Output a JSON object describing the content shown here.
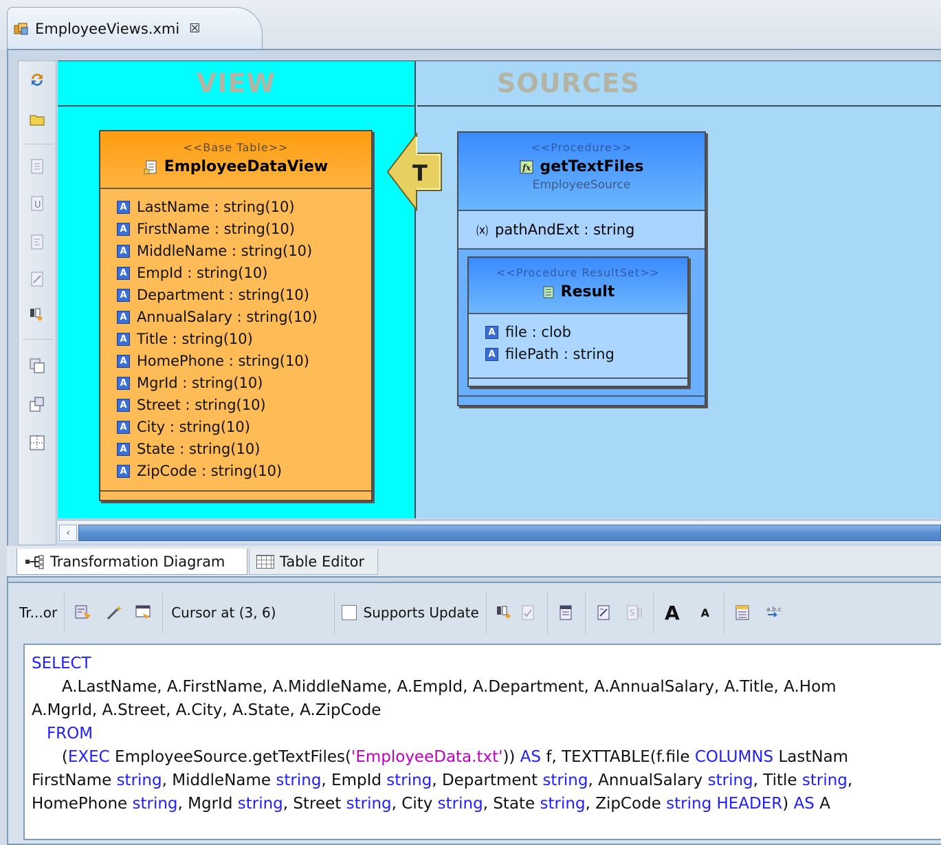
{
  "editor_tab": {
    "title": "EmployeeViews.xmi",
    "close_glyph": "☒"
  },
  "diagram": {
    "view_header": "VIEW",
    "sources_header": "SOURCES",
    "transform_label": "T",
    "view_class": {
      "stereotype": "<<Base Table>>",
      "name": "EmployeeDataView",
      "attributes": [
        "LastName : string(10)",
        "FirstName : string(10)",
        "MiddleName : string(10)",
        "EmpId : string(10)",
        "Department : string(10)",
        "AnnualSalary : string(10)",
        "Title : string(10)",
        "HomePhone : string(10)",
        "MgrId : string(10)",
        "Street : string(10)",
        "City : string(10)",
        "State : string(10)",
        "ZipCode : string(10)"
      ]
    },
    "procedure": {
      "stereotype": "<<Procedure>>",
      "name": "getTextFiles",
      "owner": "EmployeeSource",
      "parameter": "pathAndExt : string",
      "result_set": {
        "stereotype": "<<Procedure ResultSet>>",
        "name": "Result",
        "attributes": [
          "file : clob",
          "filePath : string"
        ]
      }
    },
    "attr_icon_letter": "A"
  },
  "page_tabs": {
    "diagram": "Transformation Diagram",
    "table": "Table Editor"
  },
  "sql_toolbar": {
    "title": "Tr...or",
    "cursor": "Cursor at (3, 6)",
    "supports_update": "Supports Update"
  },
  "sql": {
    "select": "SELECT",
    "cols_line1": "      A.LastName, A.FirstName, A.MiddleName, A.EmpId, A.Department, A.AnnualSalary, A.Title, A.Hom",
    "cols_line2": "A.MgrId, A.Street, A.City, A.State, A.ZipCode",
    "from": "FROM",
    "exec_kw": "EXEC",
    "exec_call": " EmployeeSource.getTextFiles(",
    "exec_arg": "'EmployeeData.txt'",
    "as_kw": "AS",
    "texttable": " f, TEXTTABLE(f.file ",
    "columns_kw": "COLUMNS",
    "lastnam": " LastNam",
    "string_kw": "string",
    "header_kw": "HEADER",
    "alias_a": " A",
    "l6": [
      "FirstName",
      "MiddleName",
      "EmpId",
      "Department",
      "AnnualSalary",
      "Title"
    ],
    "l7": [
      "HomePhone",
      "MgrId",
      "Street",
      "City",
      "State",
      "ZipCode"
    ]
  }
}
